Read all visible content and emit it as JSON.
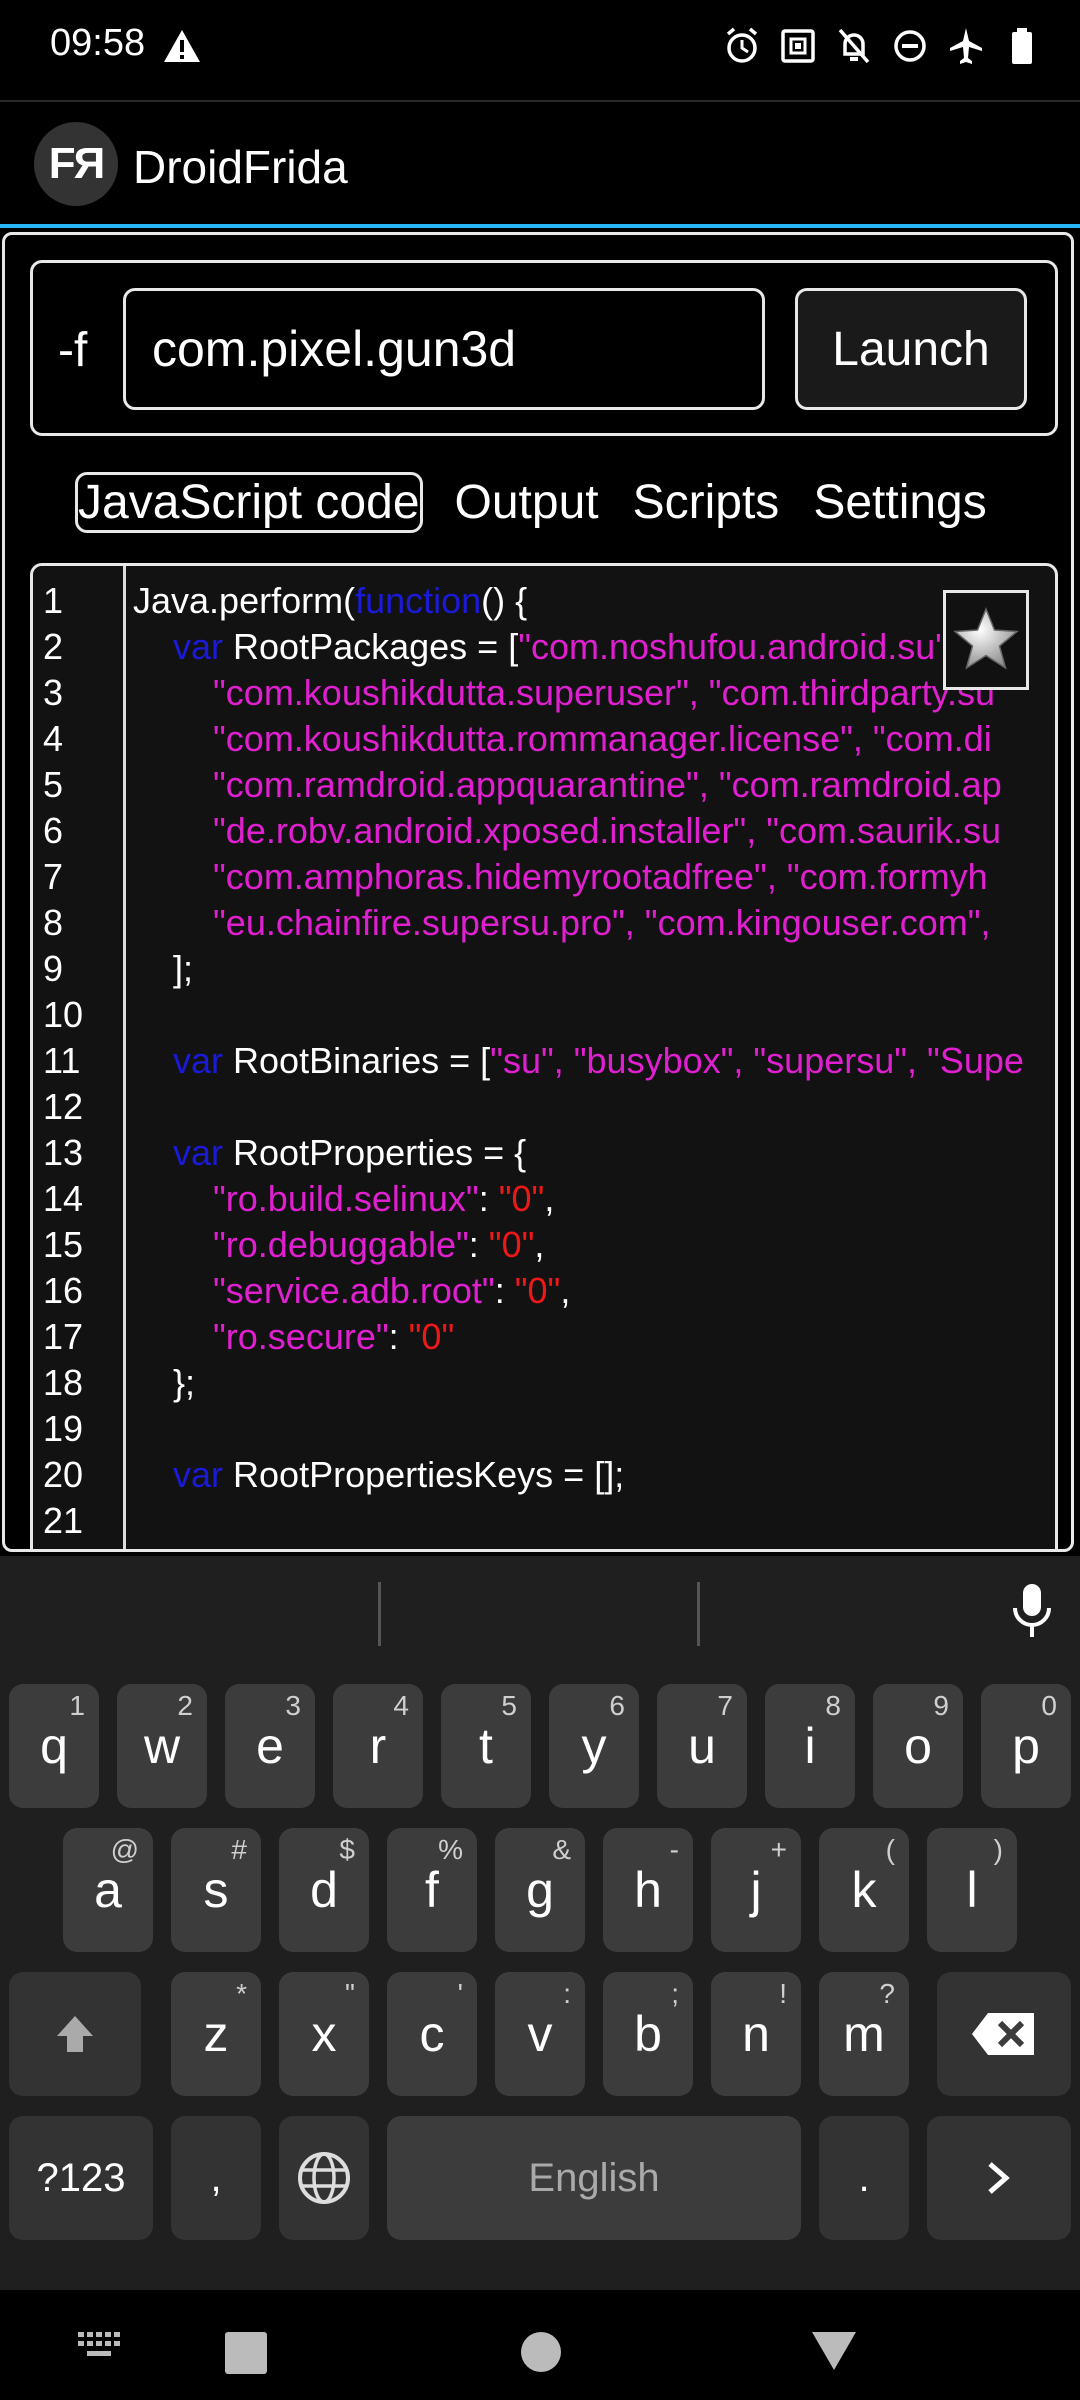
{
  "status_bar": {
    "time": "09:58"
  },
  "app": {
    "title": "DroidFrida",
    "logo_text": "FЯ"
  },
  "launcher": {
    "flag_label": "-f",
    "package_value": "com.pixel.gun3d",
    "launch_label": "Launch"
  },
  "tabs": [
    {
      "label": "JavaScript code",
      "active": true
    },
    {
      "label": "Output",
      "active": false
    },
    {
      "label": "Scripts",
      "active": false
    },
    {
      "label": "Settings",
      "active": false
    }
  ],
  "editor": {
    "line_numbers": [
      "1",
      "2",
      "3",
      "4",
      "5",
      "6",
      "7",
      "8",
      "9",
      "10",
      "11",
      "12",
      "13",
      "14",
      "15",
      "16",
      "17",
      "18",
      "19",
      "20",
      "21"
    ],
    "lines": [
      [
        [
          "",
          "Java.perform("
        ],
        [
          "kw",
          "function"
        ],
        [
          "",
          "() {"
        ]
      ],
      [
        [
          "",
          "    "
        ],
        [
          "kw",
          "var"
        ],
        [
          "",
          " RootPackages = ["
        ],
        [
          "str",
          "\"com.noshufou.android.su\", \"c"
        ]
      ],
      [
        [
          "",
          "        "
        ],
        [
          "str",
          "\"com.koushikdutta.superuser\", \"com.thirdparty.su"
        ]
      ],
      [
        [
          "",
          "        "
        ],
        [
          "str",
          "\"com.koushikdutta.rommanager.license\", \"com.di"
        ]
      ],
      [
        [
          "",
          "        "
        ],
        [
          "str",
          "\"com.ramdroid.appquarantine\", \"com.ramdroid.ap"
        ]
      ],
      [
        [
          "",
          "        "
        ],
        [
          "str",
          "\"de.robv.android.xposed.installer\", \"com.saurik.su"
        ]
      ],
      [
        [
          "",
          "        "
        ],
        [
          "str",
          "\"com.amphoras.hidemyrootadfree\", \"com.formyh"
        ]
      ],
      [
        [
          "",
          "        "
        ],
        [
          "str",
          "\"eu.chainfire.supersu.pro\", \"com.kingouser.com\", "
        ]
      ],
      [
        [
          "",
          "    ];"
        ]
      ],
      [],
      [
        [
          "",
          "    "
        ],
        [
          "kw",
          "var"
        ],
        [
          "",
          " RootBinaries = ["
        ],
        [
          "str",
          "\"su\", \"busybox\", \"supersu\", \"Supe"
        ]
      ],
      [],
      [
        [
          "",
          "    "
        ],
        [
          "kw",
          "var"
        ],
        [
          "",
          " RootProperties = {"
        ]
      ],
      [
        [
          "",
          "        "
        ],
        [
          "str",
          "\"ro.build.selinux\""
        ],
        [
          "",
          ": "
        ],
        [
          "num",
          "\"0\""
        ],
        [
          "",
          ","
        ]
      ],
      [
        [
          "",
          "        "
        ],
        [
          "str",
          "\"ro.debuggable\""
        ],
        [
          "",
          ": "
        ],
        [
          "num",
          "\"0\""
        ],
        [
          "",
          ","
        ]
      ],
      [
        [
          "",
          "        "
        ],
        [
          "str",
          "\"service.adb.root\""
        ],
        [
          "",
          ": "
        ],
        [
          "num",
          "\"0\""
        ],
        [
          "",
          ","
        ]
      ],
      [
        [
          "",
          "        "
        ],
        [
          "str",
          "\"ro.secure\""
        ],
        [
          "",
          ": "
        ],
        [
          "num",
          "\"0\""
        ]
      ],
      [
        [
          "",
          "    };"
        ]
      ],
      [],
      [
        [
          "",
          "    "
        ],
        [
          "kw",
          "var"
        ],
        [
          "",
          " RootPropertiesKeys = [];"
        ]
      ],
      []
    ]
  },
  "keyboard": {
    "row1": [
      [
        "q",
        "1"
      ],
      [
        "w",
        "2"
      ],
      [
        "e",
        "3"
      ],
      [
        "r",
        "4"
      ],
      [
        "t",
        "5"
      ],
      [
        "y",
        "6"
      ],
      [
        "u",
        "7"
      ],
      [
        "i",
        "8"
      ],
      [
        "o",
        "9"
      ],
      [
        "p",
        "0"
      ]
    ],
    "row2": [
      [
        "a",
        "@"
      ],
      [
        "s",
        "#"
      ],
      [
        "d",
        "$"
      ],
      [
        "f",
        "%"
      ],
      [
        "g",
        "&"
      ],
      [
        "h",
        "-"
      ],
      [
        "j",
        "+"
      ],
      [
        "k",
        "("
      ],
      [
        "l",
        ")"
      ]
    ],
    "row3": [
      [
        "z",
        "*"
      ],
      [
        "x",
        "\""
      ],
      [
        "c",
        "'"
      ],
      [
        "v",
        ":"
      ],
      [
        "b",
        ";"
      ],
      [
        "n",
        "!"
      ],
      [
        "m",
        "?"
      ]
    ],
    "symbols_label": "?123",
    "comma_label": ",",
    "space_label": "English",
    "period_label": "."
  },
  "colors": {
    "accent": "#29b6f6",
    "keyword": "#1a1ad8",
    "string": "#e020d0",
    "number": "#ee1818"
  },
  "icons": [
    "warning-icon",
    "alarm-icon",
    "nfc-icon",
    "notifications-off-icon",
    "dnd-icon",
    "airplane-icon",
    "battery-icon",
    "mic-icon",
    "star-icon",
    "globe-icon",
    "backspace-icon",
    "shift-icon",
    "enter-arrow-icon",
    "keyboard-switch-icon",
    "recents-icon",
    "home-icon",
    "back-icon"
  ]
}
